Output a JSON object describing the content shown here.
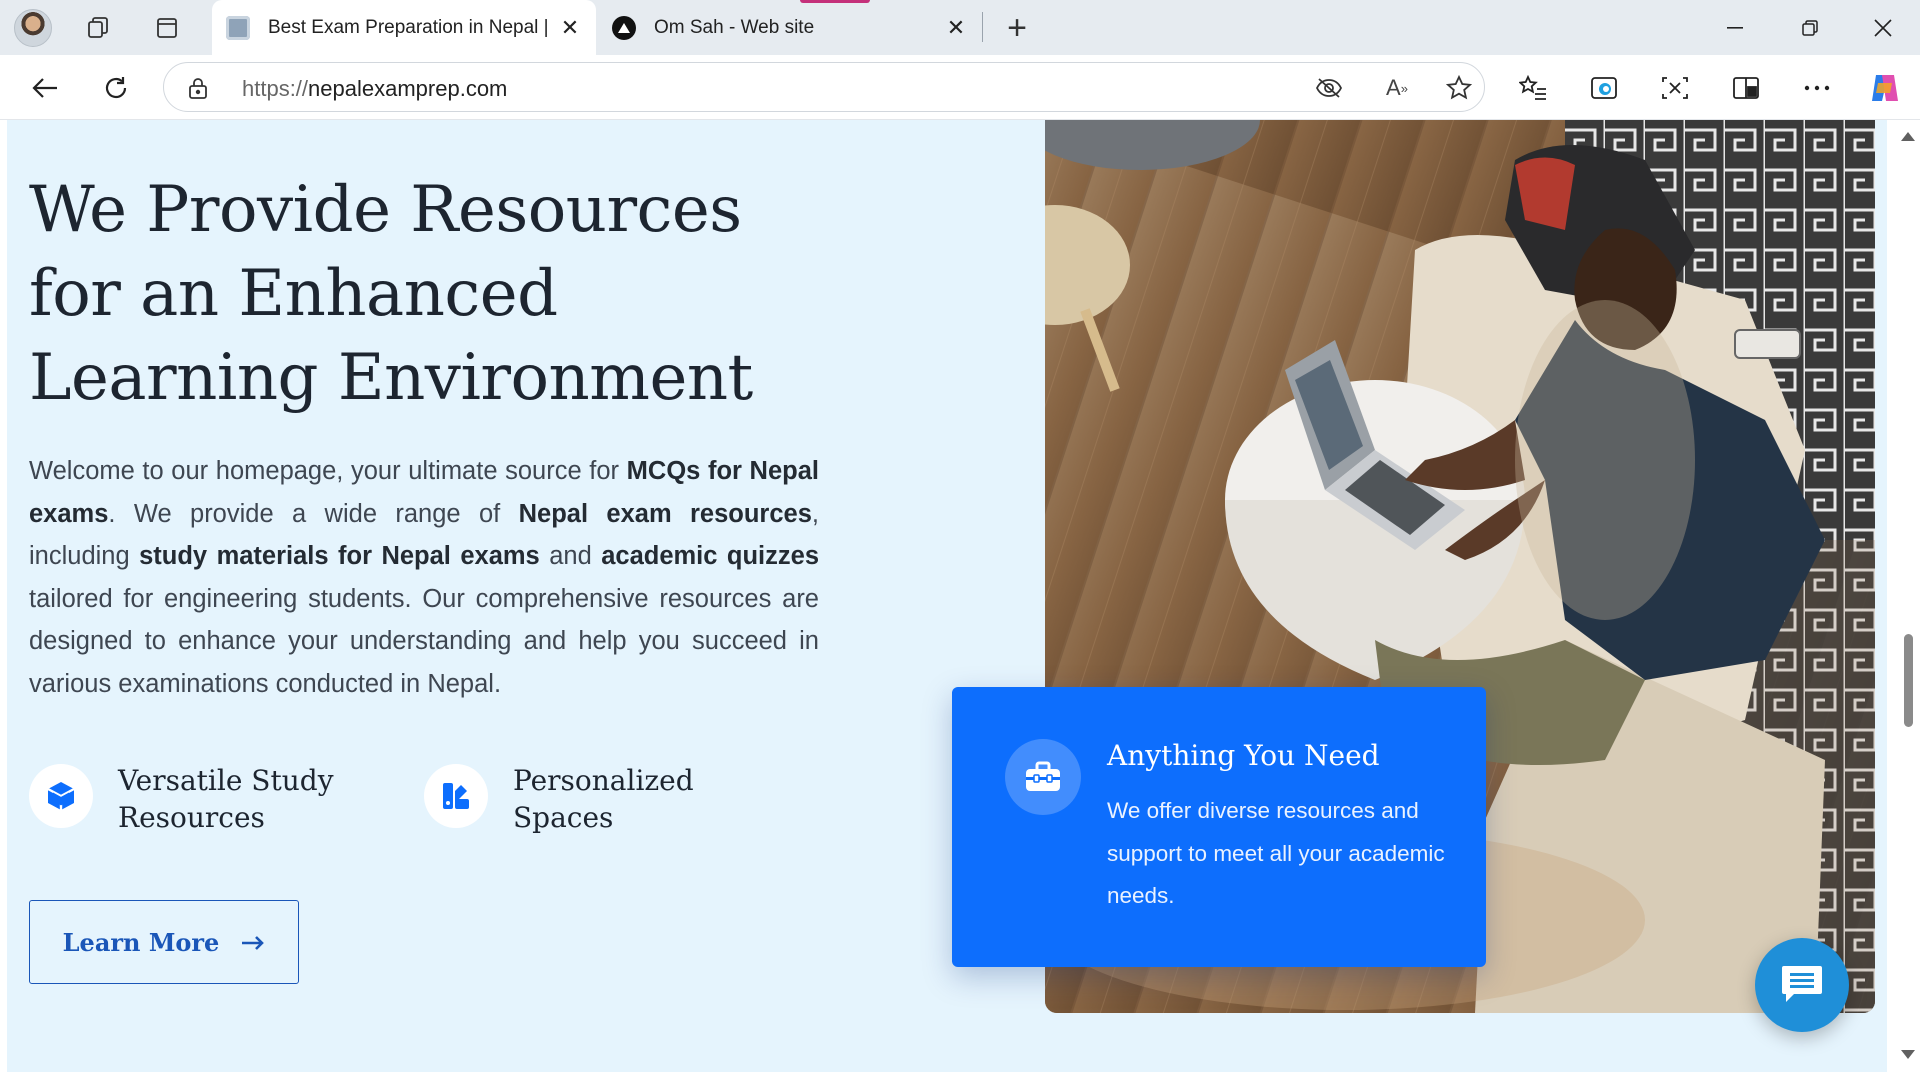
{
  "browser": {
    "tabs": [
      {
        "title": "Best Exam Preparation in Nepal | I",
        "active": true
      },
      {
        "title": "Om Sah - Web site",
        "active": false
      }
    ],
    "url_scheme": "https://",
    "url_host": "nepalexamprep.com"
  },
  "hero": {
    "heading": "We Provide Resources for an Enhanced Learning Environment",
    "intro": {
      "p1": "Welcome to our homepage, your ultimate source for ",
      "b1": "MCQs for Nepal exams",
      "p2": ". We provide a wide range of ",
      "b2": "Nepal exam resources",
      "p3": ", including ",
      "b3": "study materials for Nepal exams",
      "p4": " and ",
      "b4": "academic quizzes",
      "p5": " tailored for engineering students. Our comprehensive resources are designed to enhance your understanding and help you succeed in various examinations conducted in Nepal."
    },
    "features": [
      {
        "label": "Versatile Study Resources",
        "icon": "cube-icon"
      },
      {
        "label": "Personalized Spaces",
        "icon": "swatches-icon"
      }
    ],
    "cta_label": "Learn More",
    "card": {
      "title": "Anything You Need",
      "body": "We offer diverse resources and support to meet all your academic needs.",
      "icon": "toolbox-icon"
    }
  },
  "colors": {
    "hero_bg": "#e5f4fd",
    "accent": "#0d6efd",
    "cta": "#1a56b8",
    "chat": "#1f8fd8"
  }
}
